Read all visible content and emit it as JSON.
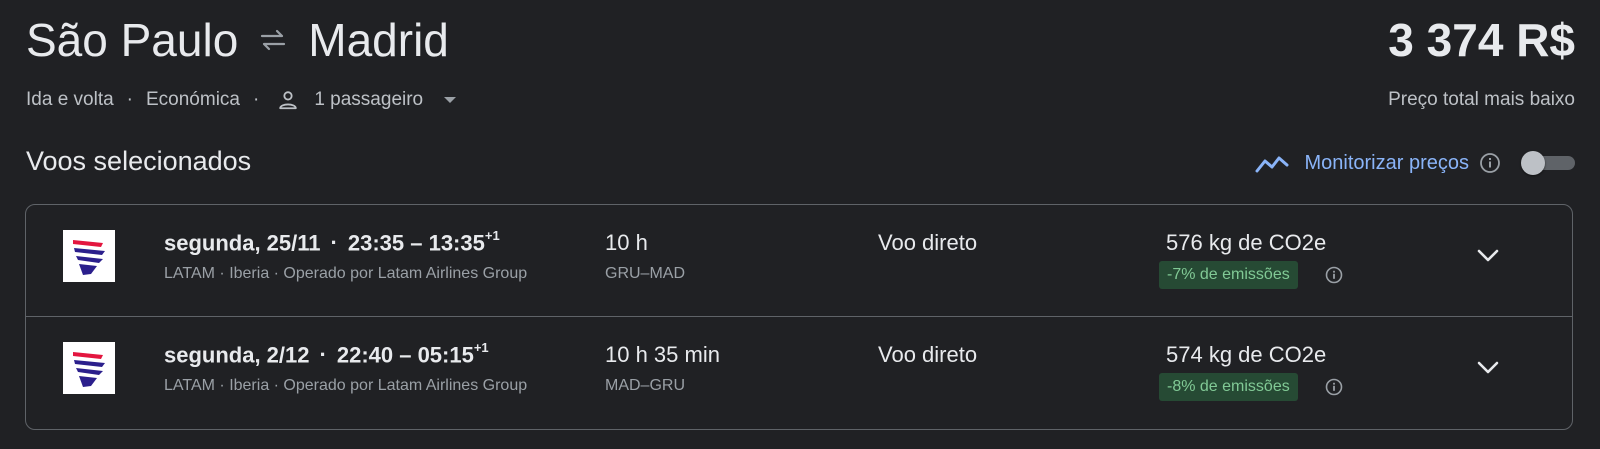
{
  "header": {
    "origin": "São Paulo",
    "destination": "Madrid",
    "trip_type": "Ida e volta",
    "cabin": "Económica",
    "passengers": "1 passageiro",
    "price": "3 374 R$",
    "price_label": "Preço total mais baixo"
  },
  "section": {
    "title": "Voos selecionados",
    "track_label": "Monitorizar preços",
    "track_enabled": false
  },
  "flights": [
    {
      "date": "segunda, 25/11",
      "times": "23:35 – 13:35",
      "day_offset": "+1",
      "airline": "LATAM · Iberia · Operado por Latam Airlines Group",
      "duration": "10 h",
      "airports": "GRU–MAD",
      "stops": "Voo direto",
      "emissions": "576 kg de CO2e",
      "emissions_badge": "-7% de emissões"
    },
    {
      "date": "segunda, 2/12",
      "times": "22:40 – 05:15",
      "day_offset": "+1",
      "airline": "LATAM · Iberia · Operado por Latam Airlines Group",
      "duration": "10 h 35 min",
      "airports": "MAD–GRU",
      "stops": "Voo direto",
      "emissions": "574 kg de CO2e",
      "emissions_badge": "-8% de emissões"
    }
  ],
  "icons": {
    "swap": "swap-arrows-icon",
    "person": "person-icon",
    "dropdown": "caret-down-icon",
    "trend": "trending-icon",
    "info": "info-icon",
    "expand": "chevron-down-icon",
    "airline_logo": "latam-logo"
  },
  "colors": {
    "background": "#202124",
    "accent": "#8ab4f8",
    "emissions_badge_bg": "#264a34",
    "emissions_badge_text": "#81c995",
    "latam_indigo": "#2b1f8c",
    "latam_red": "#e3163f"
  }
}
